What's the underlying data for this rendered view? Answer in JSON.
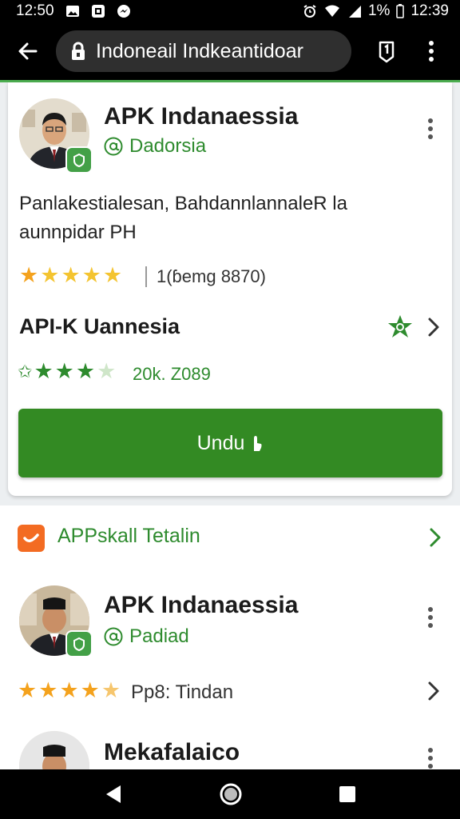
{
  "status_bar": {
    "left_time": "12:50",
    "battery": "1%",
    "right_time": "12:39",
    "icons": [
      "gallery-icon",
      "screenshot-icon",
      "messenger-icon",
      "alarm-icon",
      "wifi-icon",
      "signal-icon",
      "battery-icon"
    ]
  },
  "browser": {
    "url": "Indoneail Indkeantidoar",
    "icons": [
      "back-arrow-icon",
      "lock-icon",
      "tabs-icon",
      "kebab-menu-icon"
    ]
  },
  "colors": {
    "accent_green": "#338a23",
    "link_green": "#2e8b2e",
    "star_orange": "#f4a21d",
    "promo_orange": "#f36b22"
  },
  "card1": {
    "title": "APK Indanaessia",
    "subtitle": "Dadorsia",
    "description": "Panlakestialesan, BahdannlannaleR la aunnpidar PH",
    "rating_text": "1(ɓemg 8870)",
    "stars_rating": 5,
    "section_title": "API-K Uannesia",
    "section_rating_text": "20k. Z089",
    "section_stars_rating": 3.5,
    "download_label": "Undu"
  },
  "card2": {
    "promo_text": "APPskall Tetalin",
    "item1": {
      "title": "APK Indanaessia",
      "subtitle": "Padiad",
      "rating_text": "Pp8: Tindan",
      "stars_rating": 4.5
    },
    "item2": {
      "title": "Mekafalaico"
    }
  },
  "navbar": {
    "icons": [
      "nav-back-icon",
      "nav-home-icon",
      "nav-recents-icon"
    ]
  }
}
